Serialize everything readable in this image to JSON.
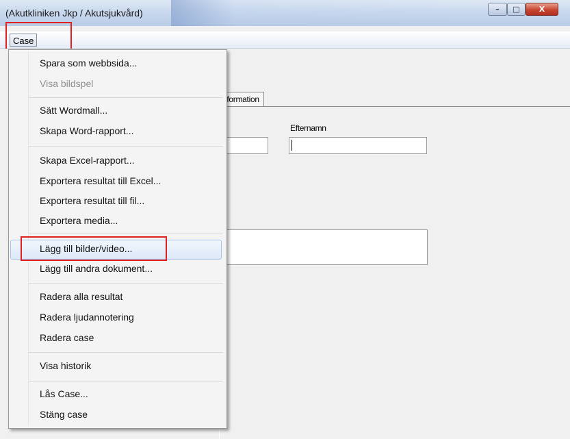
{
  "window": {
    "title": "(Akutkliniken Jkp / Akutsjukvård)",
    "controls": {
      "minimize": "–",
      "maximize": "□",
      "close": "X"
    }
  },
  "menubar": {
    "case_label": "Case"
  },
  "tab": {
    "label": "nformation"
  },
  "form": {
    "efternamn_label": "Efternamn"
  },
  "menu": {
    "items": [
      {
        "label": "Spara som webbsida...",
        "enabled": true
      },
      {
        "label": "Visa bildspel",
        "enabled": false
      },
      {
        "label": "Sätt Wordmall...",
        "enabled": true
      },
      {
        "label": "Skapa Word-rapport...",
        "enabled": true
      },
      {
        "label": "Skapa Excel-rapport...",
        "enabled": true
      },
      {
        "label": "Exportera resultat till Excel...",
        "enabled": true
      },
      {
        "label": "Exportera resultat till fil...",
        "enabled": true
      },
      {
        "label": "Exportera media...",
        "enabled": true
      },
      {
        "label": "Lägg till bilder/video...",
        "enabled": true,
        "highlighted": true
      },
      {
        "label": "Lägg till andra dokument...",
        "enabled": true
      },
      {
        "label": "Radera alla resultat",
        "enabled": true
      },
      {
        "label": "Radera ljudannotering",
        "enabled": true
      },
      {
        "label": "Radera case",
        "enabled": true
      },
      {
        "label": "Visa historik",
        "enabled": true
      },
      {
        "label": "Lås Case...",
        "enabled": true
      },
      {
        "label": "Stäng case",
        "enabled": true
      }
    ]
  },
  "colors": {
    "highlight_box": "#e02020",
    "hover_fill": "#dce9f8"
  }
}
